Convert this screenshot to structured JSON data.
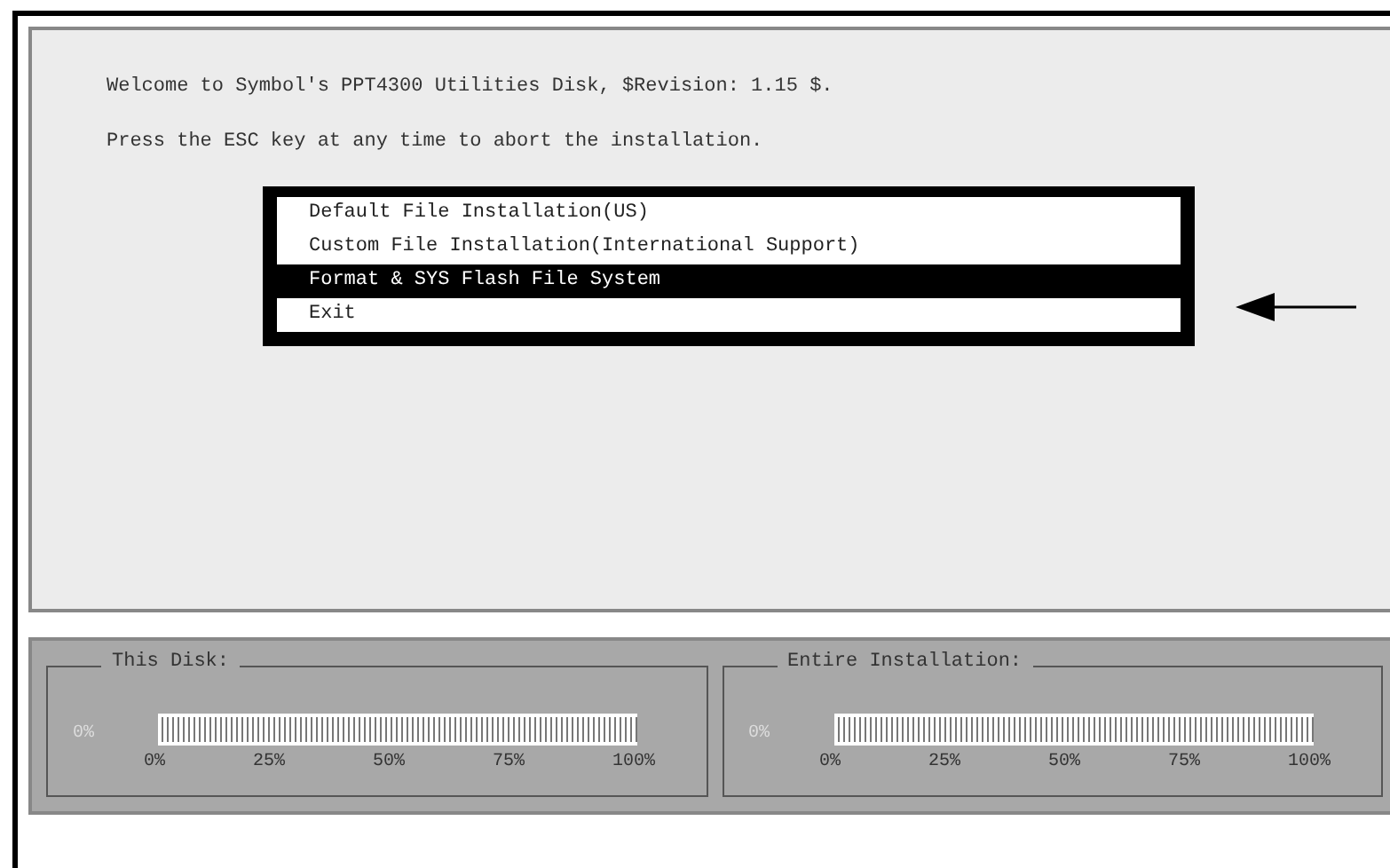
{
  "messages": [
    "Welcome to Symbol's PPT4300 Utilities Disk, $Revision: 1.15 $.",
    "Press the ESC key at any time to abort the installation."
  ],
  "menu": [
    {
      "label": "Default File Installation(US)",
      "selected": false
    },
    {
      "label": "Custom File Installation(International Support)",
      "selected": false
    },
    {
      "label": "Format & SYS Flash File System",
      "selected": true
    },
    {
      "label": "Exit",
      "selected": false
    }
  ],
  "progress": [
    {
      "title": "This Disk:",
      "reading": "0%",
      "level": 0,
      "ticks": [
        "0%",
        "25%",
        "50%",
        "75%",
        "100%"
      ]
    },
    {
      "title": "Entire Installation:",
      "reading": "0%",
      "level": 0,
      "ticks": [
        "0%",
        "25%",
        "50%",
        "75%",
        "100%"
      ]
    }
  ]
}
